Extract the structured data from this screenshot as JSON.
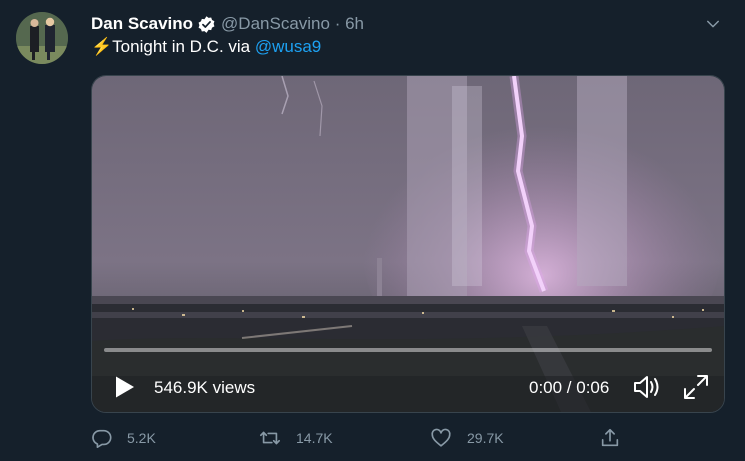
{
  "tweet": {
    "author_name": "Dan Scavino",
    "handle": "@DanScavino",
    "separator": " · ",
    "time": "6h",
    "text_emoji": "⚡",
    "text": "Tonight in D.C. via ",
    "mention": "@wusa9"
  },
  "video": {
    "views": "546.9K views",
    "time_display": "0:00 / 0:06",
    "progress": 0
  },
  "actions": {
    "replies": "5.2K",
    "retweets": "14.7K",
    "likes": "29.7K"
  },
  "colors": {
    "background": "#15202b",
    "muted_text": "#8899a6",
    "link": "#1da1f2",
    "verified": "#ffffff"
  },
  "icons": [
    "avatar",
    "verified-badge-icon",
    "chevron-down-icon",
    "lightning-emoji-icon",
    "play-icon",
    "volume-icon",
    "fullscreen-icon",
    "reply-icon",
    "retweet-icon",
    "like-icon",
    "share-icon"
  ]
}
